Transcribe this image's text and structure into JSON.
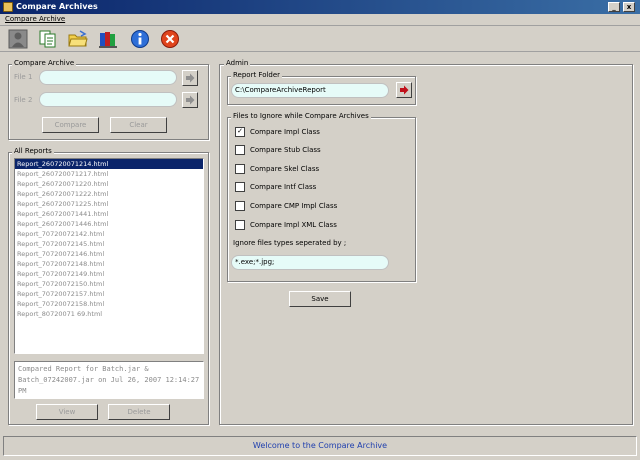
{
  "window": {
    "title": "Compare Archives",
    "minimize": "_",
    "close": "x"
  },
  "menu": {
    "items": [
      {
        "label": "Compare Archive"
      }
    ]
  },
  "toolbar": {
    "buttons": [
      {
        "icon": "user-icon"
      },
      {
        "icon": "copy-documents-icon"
      },
      {
        "icon": "open-folder-icon"
      },
      {
        "icon": "books-icon"
      },
      {
        "icon": "info-icon"
      },
      {
        "icon": "exit-icon"
      }
    ]
  },
  "compare_archive": {
    "legend": "Compare Archive",
    "file1_label": "File 1",
    "file2_label": "File 2",
    "file1_value": "",
    "file2_value": "",
    "compare_label": "Compare",
    "clear_label": "Clear"
  },
  "all_reports": {
    "legend": "All Reports",
    "items": [
      "Report_260720071214.html",
      "Report_260720071217.html",
      "Report_260720071220.html",
      "Report_260720071222.html",
      "Report_260720071225.html",
      "Report_260720071441.html",
      "Report_260720071446.html",
      "Report_70720072142.html",
      "Report_70720072145.html",
      "Report_70720072146.html",
      "Report_70720072148.html",
      "Report_70720072149.html",
      "Report_70720072150.html",
      "Report_70720072157.html",
      "Report_70720072158.html",
      "Report_80720071 69.html"
    ],
    "selected_index": 0,
    "details_text": "Compared Report for Batch.jar & Batch_07242007.jar on Jul 26, 2007 12:14:27 PM",
    "view_label": "View",
    "delete_label": "Delete"
  },
  "admin": {
    "legend": "Admin",
    "report_folder_legend": "Report Folder",
    "report_folder_value": "C:\\CompareArchiveReport",
    "ignore_legend": "Files to Ignore while Compare Archives",
    "checkboxes": [
      {
        "label": "Compare Impl Class",
        "checked": true
      },
      {
        "label": "Compare Stub Class",
        "checked": false
      },
      {
        "label": "Compare Skel Class",
        "checked": false
      },
      {
        "label": "Compare Intf Class",
        "checked": false
      },
      {
        "label": "Compare CMP Impl Class",
        "checked": false
      },
      {
        "label": "Compare Impl XML Class",
        "checked": false
      }
    ],
    "ignore_types_label": "Ignore files types seperated by ;",
    "ignore_types_value": "*.exe;*.jpg;",
    "save_label": "Save"
  },
  "status": {
    "text": "Welcome to the Compare Archive"
  },
  "colors": {
    "title_bar": "#0a246a",
    "selection": "#0a246a",
    "field_bg": "#e6fbf8",
    "status_text": "#1f3fae",
    "arrow_red": "#c0101a"
  }
}
